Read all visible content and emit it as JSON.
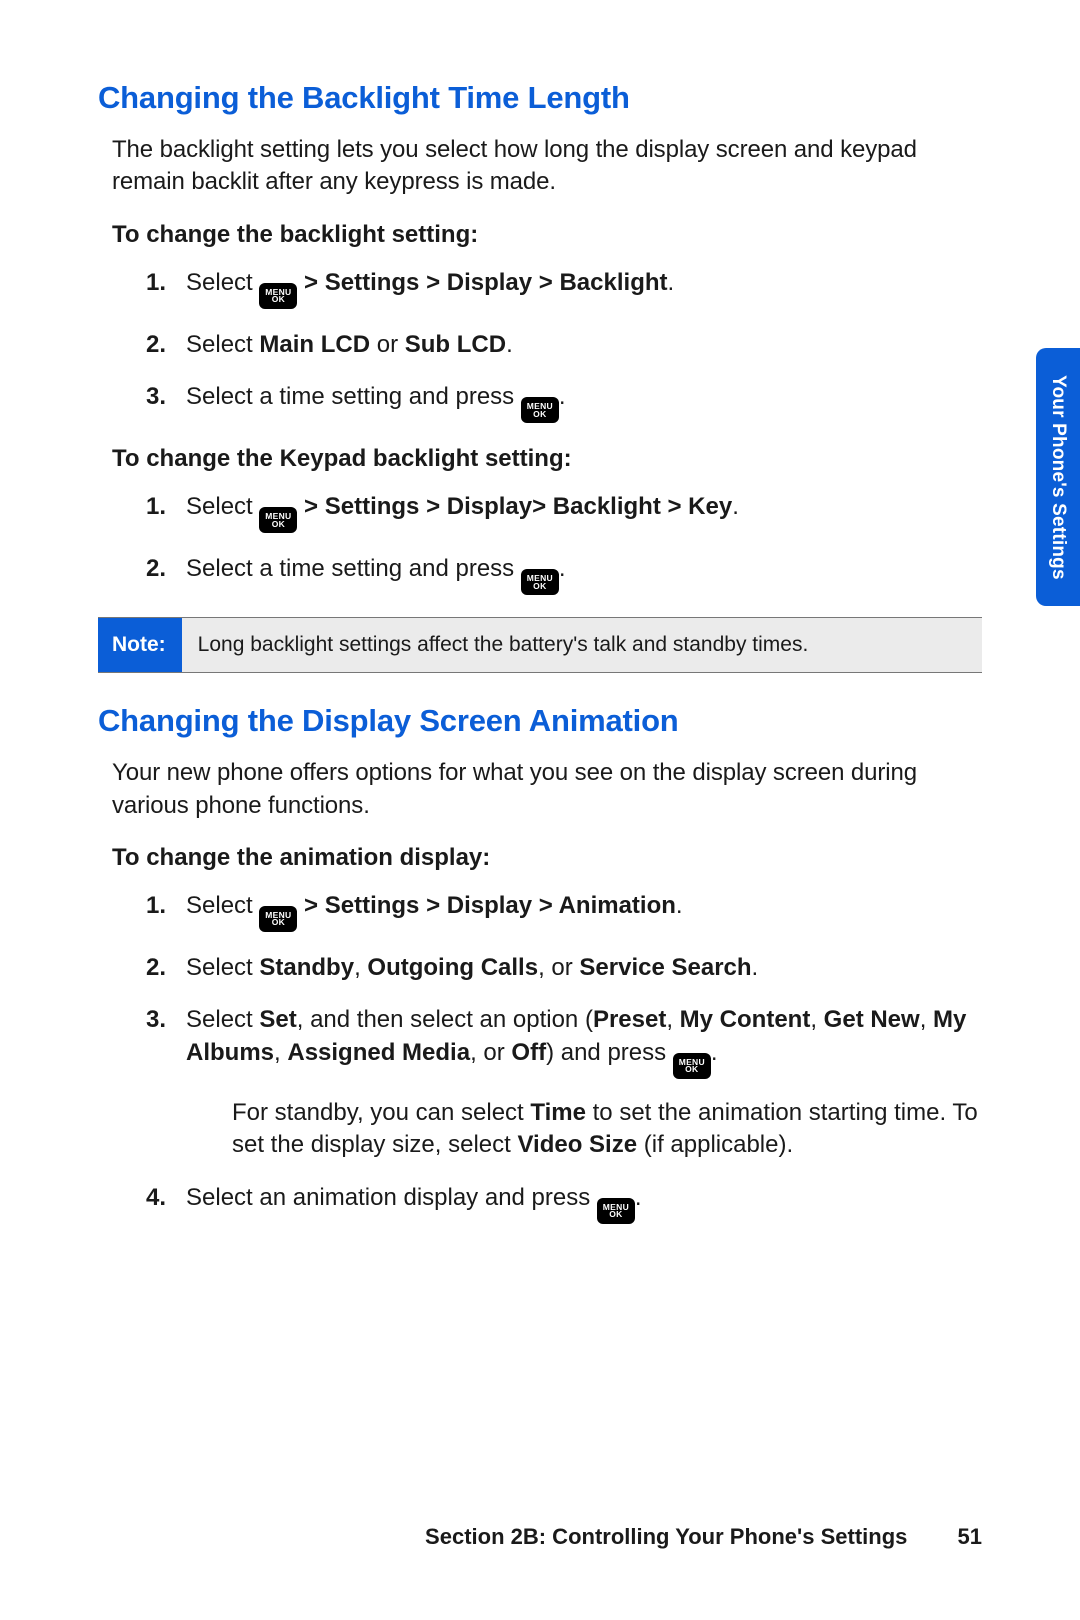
{
  "side_tab": "Your Phone's Settings",
  "section1": {
    "heading": "Changing the Backlight Time Length",
    "body": "The backlight setting lets you select how long the display screen and keypad remain backlit after any keypress is made.",
    "lead1": "To change the backlight setting:",
    "steps1": {
      "s1_pre": "Select ",
      "s1_bold": " > Settings > Display > Backlight",
      "s1_post": ".",
      "s2_pre": "Select ",
      "s2_bold1": "Main LCD",
      "s2_mid": " or ",
      "s2_bold2": "Sub LCD",
      "s2_post": ".",
      "s3_pre": "Select a time setting and press ",
      "s3_post": "."
    },
    "lead2": "To change the Keypad backlight setting:",
    "steps2": {
      "s1_pre": "Select ",
      "s1_bold": " > Settings > Display> Backlight > Key",
      "s1_post": ".",
      "s2_pre": "Select a time setting and press ",
      "s2_post": "."
    }
  },
  "note": {
    "label": "Note:",
    "text": "Long backlight settings affect the battery's talk and standby times."
  },
  "section2": {
    "heading": "Changing the Display Screen Animation",
    "body": "Your new phone offers options for what you see on the display screen during various phone functions.",
    "lead": "To change the animation display:",
    "steps": {
      "s1_pre": "Select ",
      "s1_bold": " > Settings > Display > Animation",
      "s1_post": ".",
      "s2_pre": "Select ",
      "s2_b1": "Standby",
      "s2_c1": ", ",
      "s2_b2": "Outgoing Calls",
      "s2_c2": ", or ",
      "s2_b3": "Service Search",
      "s2_post": ".",
      "s3_pre": "Select ",
      "s3_b1": "Set",
      "s3_t1": ", and then select an option (",
      "s3_b2": "Preset",
      "s3_t2": ", ",
      "s3_b3": "My Content",
      "s3_t3": ", ",
      "s3_b4": "Get New",
      "s3_t4": ", ",
      "s3_b5": "My Albums",
      "s3_t5": ", ",
      "s3_b6": "Assigned Media",
      "s3_t6": ", or ",
      "s3_b7": "Off",
      "s3_t7": ") and press ",
      "s3_post": ".",
      "s3_sub_pre": "For standby, you can select ",
      "s3_sub_b1": "Time",
      "s3_sub_t1": " to set the animation starting time. To set the display size, select ",
      "s3_sub_b2": "Video Size",
      "s3_sub_t2": " (if applicable).",
      "s4_pre": "Select an animation display and press ",
      "s4_post": "."
    }
  },
  "footer": {
    "section": "Section 2B: Controlling Your Phone's Settings",
    "page": "51"
  },
  "key": {
    "line1": "MENU",
    "line2": "OK"
  }
}
